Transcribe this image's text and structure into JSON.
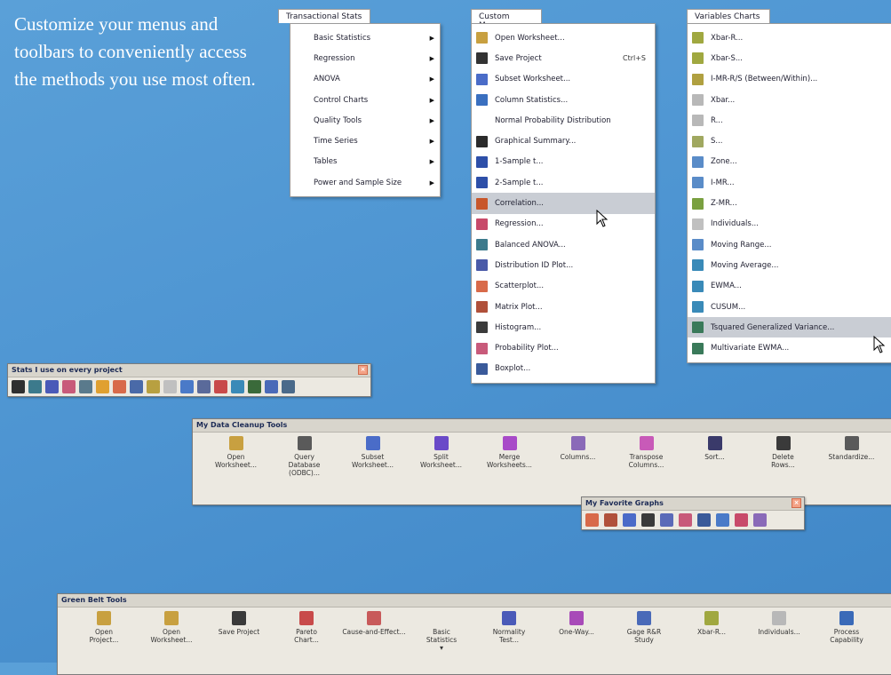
{
  "intro_text": "Customize your menus and toolbars to conveniently access the methods you use most often.",
  "menus": {
    "transactional": {
      "title": "Transactional Stats",
      "items": [
        {
          "label": "Basic Statistics",
          "submenu": true
        },
        {
          "label": "Regression",
          "submenu": true
        },
        {
          "label": "ANOVA",
          "submenu": true
        },
        {
          "label": "Control Charts",
          "submenu": true
        },
        {
          "label": "Quality Tools",
          "submenu": true
        },
        {
          "label": "Time Series",
          "submenu": true
        },
        {
          "label": "Tables",
          "submenu": true
        },
        {
          "label": "Power and Sample Size",
          "submenu": true
        }
      ]
    },
    "custom": {
      "title": "Custom Menu",
      "items": [
        {
          "label": "Open Worksheet...",
          "icon": "open-worksheet-icon",
          "color": "#c8a040"
        },
        {
          "label": "Save Project",
          "icon": "save-icon",
          "color": "#333333",
          "shortcut": "Ctrl+S"
        },
        {
          "label": "Subset Worksheet...",
          "icon": "subset-icon",
          "color": "#4a6cc8"
        },
        {
          "label": "Column Statistics...",
          "icon": "column-stats-icon",
          "color": "#3a6fbf"
        },
        {
          "label": "Normal Probability Distribution",
          "icon": "",
          "color": ""
        },
        {
          "label": "Graphical Summary...",
          "icon": "graphical-summary-icon",
          "color": "#2b2b2b"
        },
        {
          "label": "1-Sample t...",
          "icon": "one-sample-t-icon",
          "color": "#2d4fa8"
        },
        {
          "label": "2-Sample t...",
          "icon": "two-sample-t-icon",
          "color": "#2d4fa8"
        },
        {
          "label": "Correlation...",
          "icon": "correlation-icon",
          "color": "#c8562a",
          "highlight": true
        },
        {
          "label": "Regression...",
          "icon": "regression-icon",
          "color": "#c84a6a"
        },
        {
          "label": "Balanced ANOVA...",
          "icon": "anova-icon",
          "color": "#3c7a8c"
        },
        {
          "label": "Distribution ID Plot...",
          "icon": "distribution-icon",
          "color": "#4a5aa8"
        },
        {
          "label": "Scatterplot...",
          "icon": "scatterplot-icon",
          "color": "#d86a4a"
        },
        {
          "label": "Matrix Plot...",
          "icon": "matrix-plot-icon",
          "color": "#b0503a"
        },
        {
          "label": "Histogram...",
          "icon": "histogram-icon",
          "color": "#3b3b3b"
        },
        {
          "label": "Probability Plot...",
          "icon": "probability-plot-icon",
          "color": "#c85a7a"
        },
        {
          "label": "Boxplot...",
          "icon": "boxplot-icon",
          "color": "#3a5a9a"
        }
      ]
    },
    "variables": {
      "title": "Variables Charts",
      "items": [
        {
          "label": "Xbar-R...",
          "color": "#a0a840"
        },
        {
          "label": "Xbar-S...",
          "color": "#a0a840"
        },
        {
          "label": "I-MR-R/S (Between/Within)...",
          "color": "#b0a040"
        },
        {
          "label": "Xbar...",
          "color": "#b8b8b8"
        },
        {
          "label": "R...",
          "color": "#b8b8b8"
        },
        {
          "label": "S...",
          "color": "#a0a860"
        },
        {
          "label": "Zone...",
          "color": "#5a8cc8"
        },
        {
          "label": "I-MR...",
          "color": "#5a8cc8"
        },
        {
          "label": "Z-MR...",
          "color": "#7aa040"
        },
        {
          "label": "Individuals...",
          "color": "#c0c0c0"
        },
        {
          "label": "Moving Range...",
          "color": "#5a8cc8"
        },
        {
          "label": "Moving Average...",
          "color": "#3a8ab8"
        },
        {
          "label": "EWMA...",
          "color": "#3a8ab8"
        },
        {
          "label": "CUSUM...",
          "color": "#3a8ab8"
        },
        {
          "label": "Tsquared Generalized Variance...",
          "color": "#3a7a5a",
          "highlight": true
        },
        {
          "label": "Multivariate EWMA...",
          "color": "#3a7a5a"
        }
      ]
    }
  },
  "toolbars": {
    "stats": {
      "title": "Stats I use on every project",
      "icons": [
        {
          "name": "graphical-summary-icon",
          "color": "#2f2f2f"
        },
        {
          "name": "anova-icon",
          "color": "#3c7a8c"
        },
        {
          "name": "normality-icon",
          "color": "#4a5ab8"
        },
        {
          "name": "probability-plot-icon",
          "color": "#c85a7a"
        },
        {
          "name": "balanced-anova-icon",
          "color": "#5a7a8c"
        },
        {
          "name": "individual-value-icon",
          "color": "#e0a030"
        },
        {
          "name": "matrix-plot-icon",
          "color": "#d86a4a"
        },
        {
          "name": "box-chart-icon",
          "color": "#4a6aa8"
        },
        {
          "name": "xbar-icon",
          "color": "#b8a040"
        },
        {
          "name": "run-chart-icon",
          "color": "#c0c0c0"
        },
        {
          "name": "scatter-icon",
          "color": "#4a7ac8"
        },
        {
          "name": "cause-effect-icon",
          "color": "#5a6a9a"
        },
        {
          "name": "pareto-icon",
          "color": "#c84a4a"
        },
        {
          "name": "capability-icon",
          "color": "#3a8ab8"
        },
        {
          "name": "bar-chart-icon",
          "color": "#3a6a3a"
        },
        {
          "name": "gage-icon",
          "color": "#4a6ab8"
        },
        {
          "name": "close-x-icon",
          "color": "#4a6a8a"
        }
      ]
    },
    "cleanup": {
      "title": "My Data Cleanup Tools",
      "buttons": [
        {
          "label": "Open\nWorksheet...",
          "icon": "open-worksheet-icon",
          "color": "#c8a040"
        },
        {
          "label": "Query\nDatabase\n(ODBC)...",
          "icon": "query-database-icon",
          "color": "#5a5a5a"
        },
        {
          "label": "Subset\nWorksheet...",
          "icon": "subset-icon",
          "color": "#4a6cc8"
        },
        {
          "label": "Split\nWorksheet...",
          "icon": "split-icon",
          "color": "#6a4ac8"
        },
        {
          "label": "Merge\nWorksheets...",
          "icon": "merge-icon",
          "color": "#a84ac8"
        },
        {
          "label": "Columns...",
          "icon": "columns-icon",
          "color": "#8a6ab8"
        },
        {
          "label": "Transpose\nColumns...",
          "icon": "transpose-icon",
          "color": "#c85ab8"
        },
        {
          "label": "Sort...",
          "icon": "sort-icon",
          "color": "#3a3a6a"
        },
        {
          "label": "Delete\nRows...",
          "icon": "delete-rows-icon",
          "color": "#3a3a3a"
        },
        {
          "label": "Standardize...",
          "icon": "standardize-icon",
          "color": "#5a5a5a"
        }
      ]
    },
    "graphs": {
      "title": "My Favorite Graphs",
      "icons": [
        {
          "name": "scatterplot-icon",
          "color": "#d86a4a"
        },
        {
          "name": "matrix-plot-icon",
          "color": "#b0503a"
        },
        {
          "name": "marginal-plot-icon",
          "color": "#4a6ac8"
        },
        {
          "name": "histogram-icon",
          "color": "#3a3a3a"
        },
        {
          "name": "dotplot-icon",
          "color": "#5a6ab8"
        },
        {
          "name": "probability-plot-icon",
          "color": "#c85a7a"
        },
        {
          "name": "boxplot-icon",
          "color": "#3a5a9a"
        },
        {
          "name": "interval-plot-icon",
          "color": "#4a7ac8"
        },
        {
          "name": "individual-value-icon",
          "color": "#c84a6a"
        },
        {
          "name": "line-plot-icon",
          "color": "#8a6ab8"
        }
      ]
    },
    "greenbelt": {
      "title": "Green Belt Tools",
      "buttons": [
        {
          "label": "Open\nProject...",
          "icon": "open-project-icon",
          "color": "#c8a040"
        },
        {
          "label": "Open\nWorksheet...",
          "icon": "open-worksheet-icon",
          "color": "#c8a040"
        },
        {
          "label": "Save Project",
          "icon": "save-icon",
          "color": "#3a3a3a"
        },
        {
          "label": "Pareto\nChart...",
          "icon": "pareto-icon",
          "color": "#c84a4a"
        },
        {
          "label": "Cause-and-Effect...",
          "icon": "cause-effect-icon",
          "color": "#c85a5a"
        },
        {
          "label": "Basic\nStatistics",
          "icon": "",
          "color": "",
          "dropdown": true
        },
        {
          "label": "Normality\nTest...",
          "icon": "normality-icon",
          "color": "#4a5ab8"
        },
        {
          "label": "One-Way...",
          "icon": "one-way-icon",
          "color": "#a84ab8"
        },
        {
          "label": "Gage R&R\nStudy",
          "icon": "gage-icon",
          "color": "#4a6ab8"
        },
        {
          "label": "Xbar-R...",
          "icon": "xbar-r-icon",
          "color": "#a0a840"
        },
        {
          "label": "Individuals...",
          "icon": "individuals-icon",
          "color": "#b8b8b8"
        },
        {
          "label": "Process\nCapability",
          "icon": "process-capability-icon",
          "color": "#3a6ab8"
        }
      ]
    }
  }
}
